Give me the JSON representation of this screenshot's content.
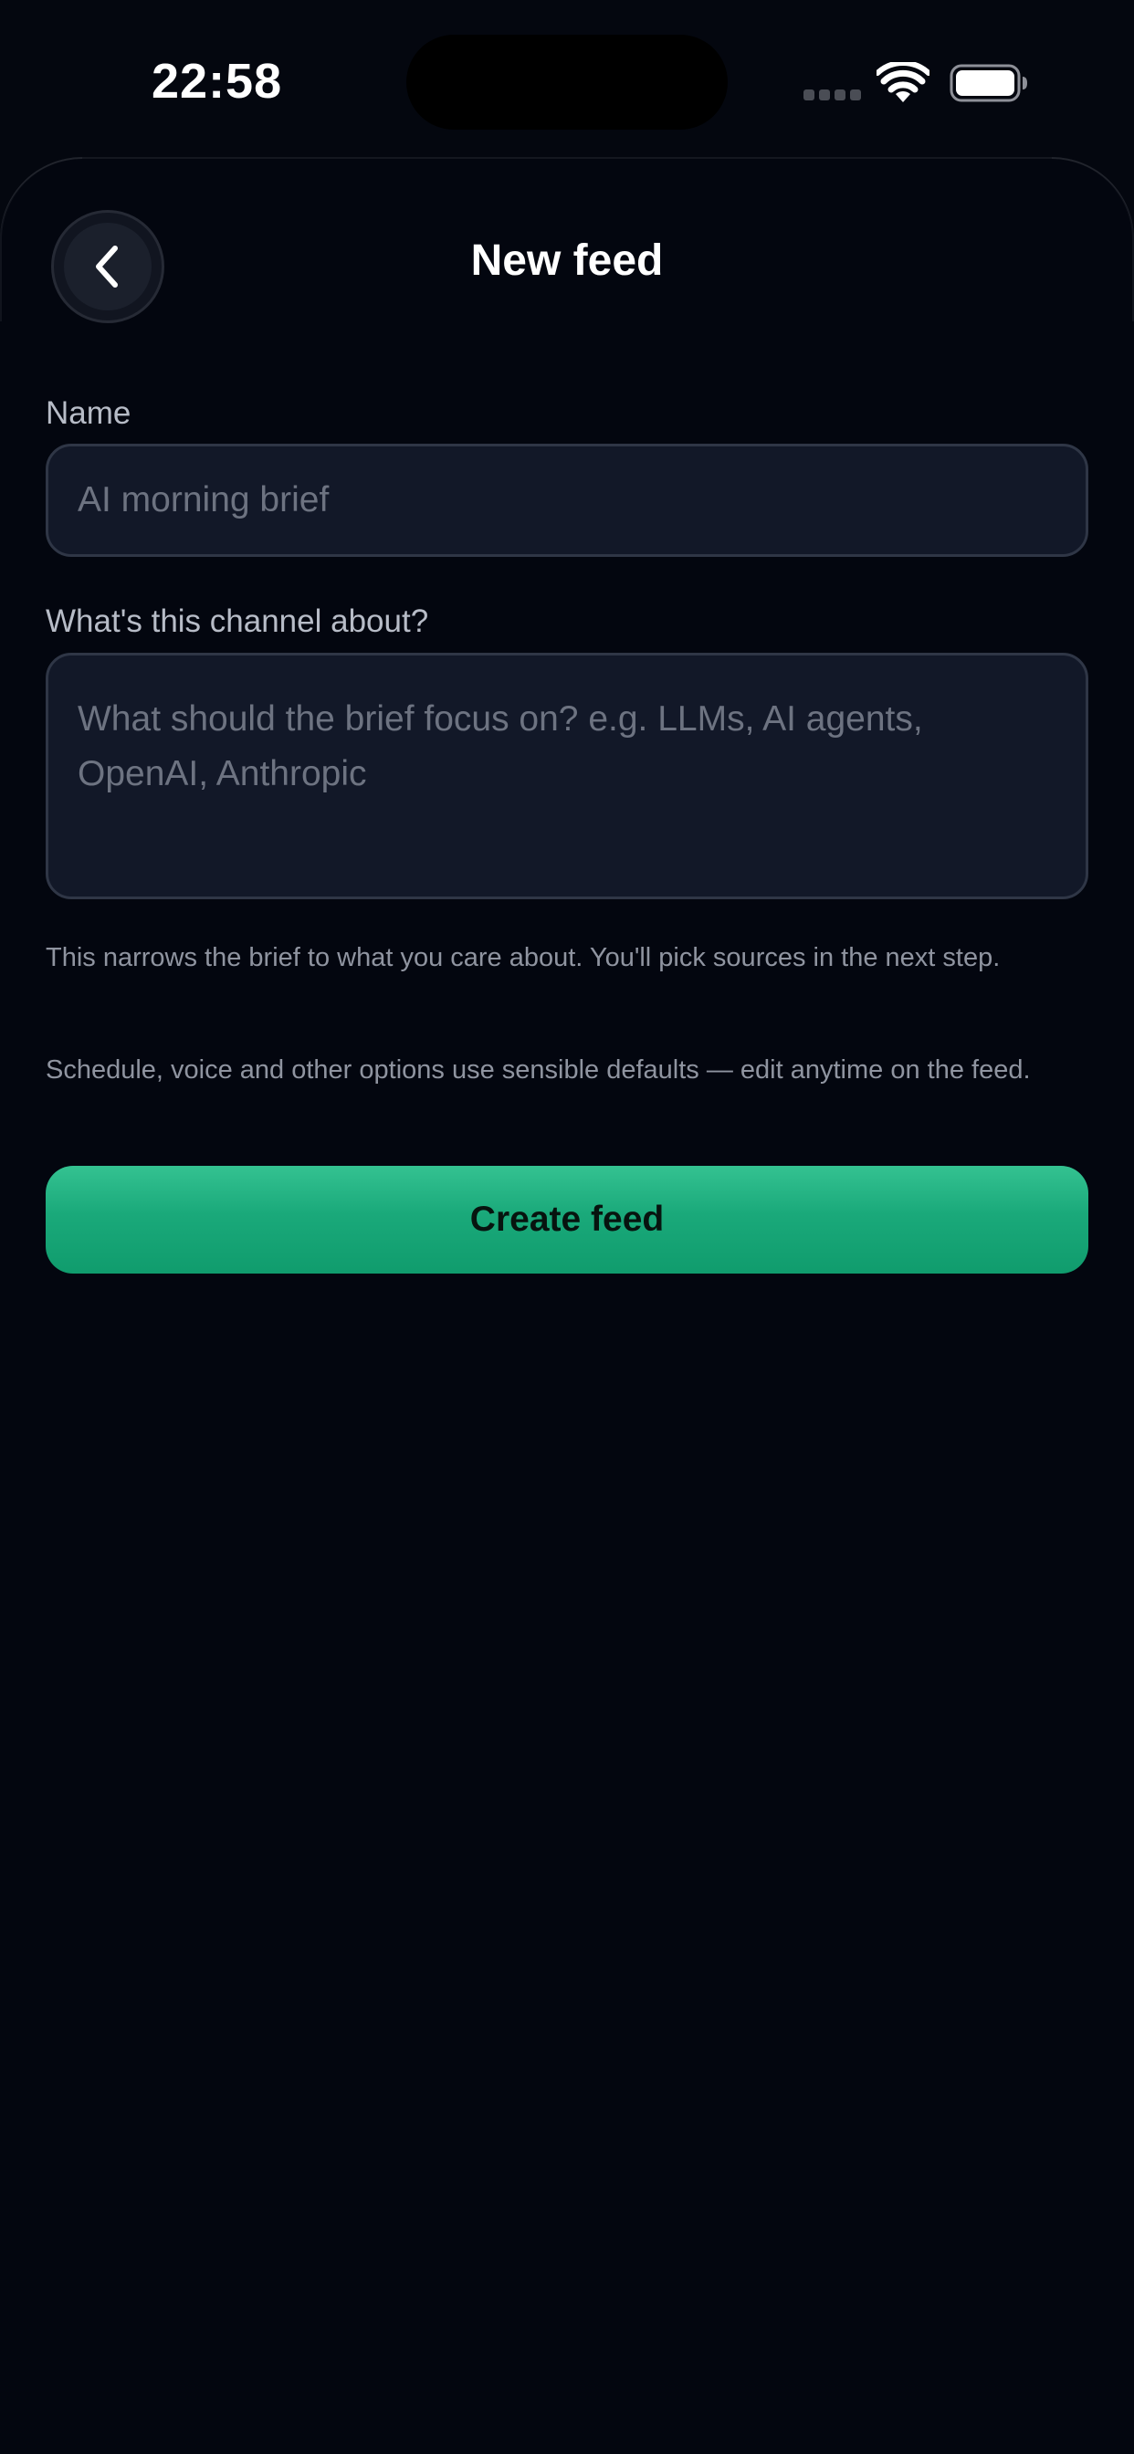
{
  "status_bar": {
    "time": "22:58"
  },
  "header": {
    "title": "New feed",
    "back_icon": "chevron-left-icon"
  },
  "form": {
    "name_label": "Name",
    "name_value": "",
    "name_placeholder": "AI morning brief",
    "about_label": "What's this channel about?",
    "about_value": "",
    "about_placeholder": "What should the brief focus on? e.g. LLMs, AI agents, OpenAI, Anthropic",
    "help_text_1": "This narrows the brief to what you care about. You'll pick sources in the next step.",
    "help_text_2": "Schedule, voice and other options use sensible defaults — edit anytime on the feed.",
    "submit_label": "Create feed"
  },
  "colors": {
    "background": "#04070f",
    "input_background": "#121828",
    "accent": "#1aa97a"
  }
}
